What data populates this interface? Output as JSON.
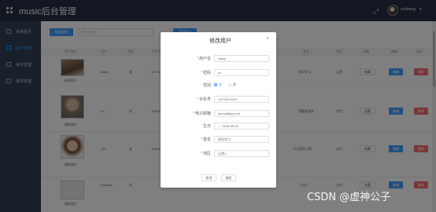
{
  "header": {
    "title": "music后台管理",
    "username": "xusheng",
    "caret": "▾"
  },
  "sidebar": {
    "items": [
      {
        "label": "系统首页"
      },
      {
        "label": "用户管理"
      },
      {
        "label": "歌手管理"
      },
      {
        "label": "歌单管理"
      }
    ]
  },
  "toolbar": {
    "batch_delete_label": "批量删除",
    "search_placeholder": "筛选关键词",
    "add_label": "添加用户"
  },
  "table": {
    "headers": [
      "用户图片",
      "用户",
      "性别",
      "手机号",
      "签名",
      "地区",
      "收藏",
      "编辑",
      "操作"
    ],
    "update_photo_label": "更新图片",
    "favorites_label": "收藏",
    "edit_label": "编辑",
    "delete_label": "删除",
    "rows": [
      {
        "name": "wang",
        "gender": "女",
        "phone": "13776412…",
        "signature": "好好学习",
        "region": "山西"
      },
      {
        "name": "xzj",
        "gender": "男",
        "phone": "13254933…",
        "signature": "我最爱周杰",
        "region": "北京"
      },
      {
        "name": "789",
        "gender": "女",
        "phone": "13654371…",
        "signature": "今天我开心啊",
        "region": "北京"
      },
      {
        "name": "bascfam",
        "gender": "男",
        "phone": "…",
        "signature": "0987",
        "region": "北京"
      }
    ]
  },
  "dialog": {
    "title": "修改用户",
    "close_glyph": "×",
    "fields": {
      "username": {
        "label": "用户名",
        "value": "wang"
      },
      "password": {
        "label": "密码",
        "value": "•••"
      },
      "gender": {
        "label": "性别",
        "options": [
          "女",
          "男"
        ],
        "selected": "女"
      },
      "phone": {
        "label": "手机号",
        "value": "13776412237"
      },
      "email": {
        "label": "电子邮箱",
        "value": "yoona@qq.com"
      },
      "birthday": {
        "label": "生日",
        "value": "2016-05-24"
      },
      "signature": {
        "label": "签名",
        "value": "好好学习"
      },
      "region": {
        "label": "地区",
        "value": "山西1"
      }
    },
    "cancel_label": "取消",
    "confirm_label": "确定"
  },
  "watermark": "CSDN @虚神公子",
  "colors": {
    "header_bg": "#242f42",
    "sidebar_bg": "#324157",
    "primary": "#409eff",
    "danger": "#f56c6c"
  }
}
